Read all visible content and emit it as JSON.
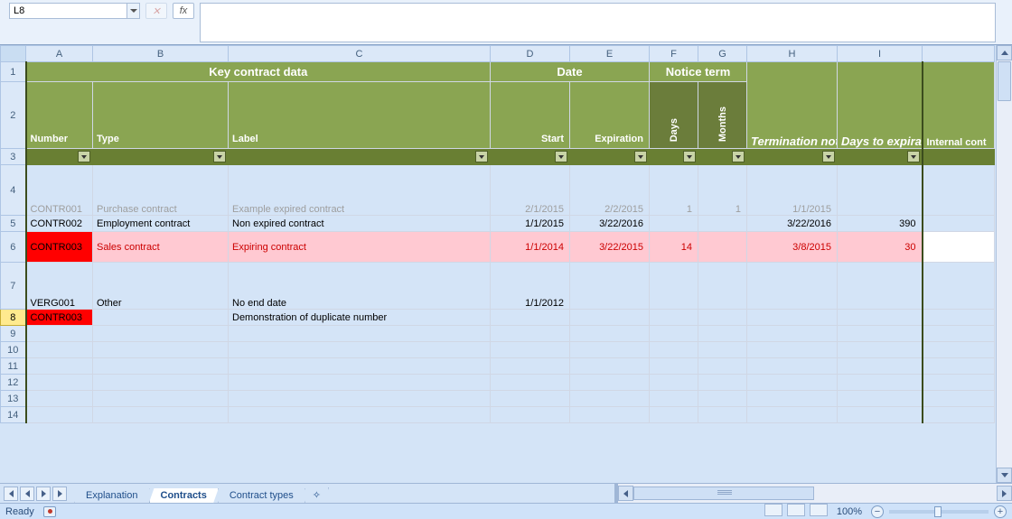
{
  "formula_bar": {
    "cell_ref": "L8",
    "formula": ""
  },
  "columns": [
    "A",
    "B",
    "C",
    "D",
    "E",
    "F",
    "G",
    "H",
    "I"
  ],
  "header_row": {
    "key_contract": "Key contract data",
    "date": "Date",
    "notice_term": "Notice term"
  },
  "subheaders": {
    "number": "Number",
    "type": "Type",
    "label": "Label",
    "start": "Start",
    "expiration": "Expiration",
    "days": "Days",
    "months": "Months",
    "term_notice": "Termination notice date",
    "days_to_exp": "Days to expiration",
    "internal": "Internal cont"
  },
  "rows": [
    {
      "n": "4",
      "num": "CONTR001",
      "type": "Purchase contract",
      "label": "Example expired contract",
      "start": "2/1/2015",
      "exp": "2/2/2015",
      "days": "1",
      "months": "1",
      "term": "1/1/2015",
      "dte": ""
    },
    {
      "n": "5",
      "num": "CONTR002",
      "type": "Employment contract",
      "label": "Non expired contract",
      "start": "1/1/2015",
      "exp": "3/22/2016",
      "days": "",
      "months": "",
      "term": "3/22/2016",
      "dte": "390"
    },
    {
      "n": "6",
      "num": "CONTR003",
      "type": "Sales contract",
      "label": "Expiring contract",
      "start": "1/1/2014",
      "exp": "3/22/2015",
      "days": "14",
      "months": "",
      "term": "3/8/2015",
      "dte": "30"
    },
    {
      "n": "7",
      "num": "VERG001",
      "type": "Other",
      "label": "No end date",
      "start": "1/1/2012",
      "exp": "",
      "days": "",
      "months": "",
      "term": "",
      "dte": ""
    },
    {
      "n": "8",
      "num": "CONTR003",
      "type": "",
      "label": "Demonstration of duplicate number",
      "start": "",
      "exp": "",
      "days": "",
      "months": "",
      "term": "",
      "dte": ""
    }
  ],
  "blank_rows": [
    "9",
    "10",
    "11",
    "12",
    "13",
    "14"
  ],
  "tabs": {
    "t1": "Explanation",
    "t2": "Contracts",
    "t3": "Contract types"
  },
  "status": {
    "ready": "Ready",
    "zoom": "100%"
  }
}
